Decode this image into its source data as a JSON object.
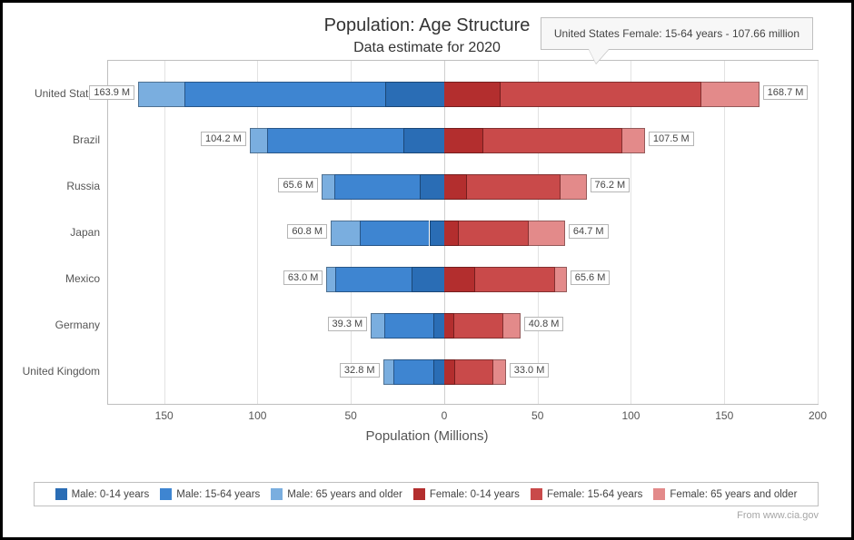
{
  "title": "Population: Age Structure",
  "subtitle": "Data estimate for 2020",
  "x_axis_title": "Population (Millions)",
  "source": "From www.cia.gov",
  "tooltip": "United States Female: 15-64 years - 107.66 million",
  "x_ticks": [
    "150",
    "100",
    "50",
    "0",
    "50",
    "100",
    "150",
    "200"
  ],
  "legend": [
    {
      "label": "Male: 0-14 years",
      "cls": "m0"
    },
    {
      "label": "Male: 15-64 years",
      "cls": "m1"
    },
    {
      "label": "Male: 65 years and older",
      "cls": "m2"
    },
    {
      "label": "Female: 0-14 years",
      "cls": "f0"
    },
    {
      "label": "Female: 15-64 years",
      "cls": "f1"
    },
    {
      "label": "Female: 65 years and older",
      "cls": "f2"
    }
  ],
  "chart_data": {
    "type": "bar",
    "orientation": "horizontal-diverging",
    "title": "Population: Age Structure",
    "subtitle": "Data estimate for 2020",
    "xlabel": "Population (Millions)",
    "ylabel": "",
    "x_range": [
      -180,
      200
    ],
    "categories": [
      "United States",
      "Brazil",
      "Russia",
      "Japan",
      "Mexico",
      "Germany",
      "United Kingdom"
    ],
    "series": [
      {
        "name": "Male: 0-14 years",
        "side": "male",
        "values": [
          31.5,
          22.0,
          13.0,
          8.0,
          17.3,
          5.8,
          6.0
        ]
      },
      {
        "name": "Male: 15-64 years",
        "side": "male",
        "values": [
          107.5,
          73.0,
          46.0,
          37.0,
          41.0,
          26.5,
          21.0
        ]
      },
      {
        "name": "Male: 65 years and older",
        "side": "male",
        "values": [
          24.9,
          9.2,
          6.6,
          15.8,
          4.7,
          7.0,
          5.8
        ]
      },
      {
        "name": "Female: 0-14 years",
        "side": "female",
        "values": [
          30.0,
          21.0,
          12.3,
          7.6,
          16.6,
          5.5,
          5.7
        ]
      },
      {
        "name": "Female: 15-64 years",
        "side": "female",
        "values": [
          107.66,
          74.5,
          50.0,
          37.5,
          43.0,
          26.0,
          20.8
        ]
      },
      {
        "name": "Female: 65 years and older",
        "side": "female",
        "values": [
          31.04,
          12.0,
          13.9,
          19.6,
          6.0,
          9.3,
          6.5
        ]
      }
    ],
    "totals": {
      "male": [
        "163.9 M",
        "104.2 M",
        "65.6 M",
        "60.8 M",
        "63.0 M",
        "39.3 M",
        "32.8 M"
      ],
      "female": [
        "168.7 M",
        "107.5 M",
        "76.2 M",
        "64.7 M",
        "65.6 M",
        "40.8 M",
        "33.0 M"
      ]
    }
  }
}
